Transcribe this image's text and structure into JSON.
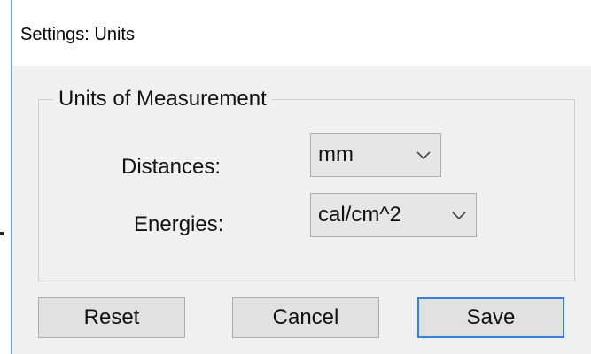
{
  "window": {
    "title": "Settings: Units"
  },
  "group": {
    "title": "Units of Measurement"
  },
  "fields": {
    "distances": {
      "label": "Distances:",
      "value": "mm"
    },
    "energies": {
      "label": "Energies:",
      "value": "cal/cm^2"
    }
  },
  "buttons": {
    "reset": "Reset",
    "cancel": "Cancel",
    "save": "Save"
  },
  "icons": {
    "dropdown": "chevron-down-icon"
  },
  "colors": {
    "dialog_background": "#f0f0f0",
    "default_button_border": "#3c7fd6",
    "window_border": "#6f9fd4"
  }
}
